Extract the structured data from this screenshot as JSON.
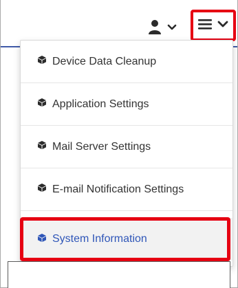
{
  "header": {
    "user_icon": "user-icon",
    "user_chevron": "chevron-down-icon",
    "menu_icon": "hamburger-menu-icon",
    "menu_chevron": "chevron-down-icon"
  },
  "colors": {
    "accent_blue": "#3f59a8",
    "highlight_red": "#e60012",
    "active_text": "#2f56b8",
    "text_dark": "#333333"
  },
  "menu": {
    "items": [
      {
        "label": "Device Data Cleanup",
        "icon": "cube-icon"
      },
      {
        "label": "Application Settings",
        "icon": "cube-icon"
      },
      {
        "label": "Mail Server Settings",
        "icon": "cube-icon"
      },
      {
        "label": "E-mail Notification Settings",
        "icon": "cube-icon"
      },
      {
        "label": "System Information",
        "icon": "cube-icon",
        "active": true
      }
    ]
  }
}
